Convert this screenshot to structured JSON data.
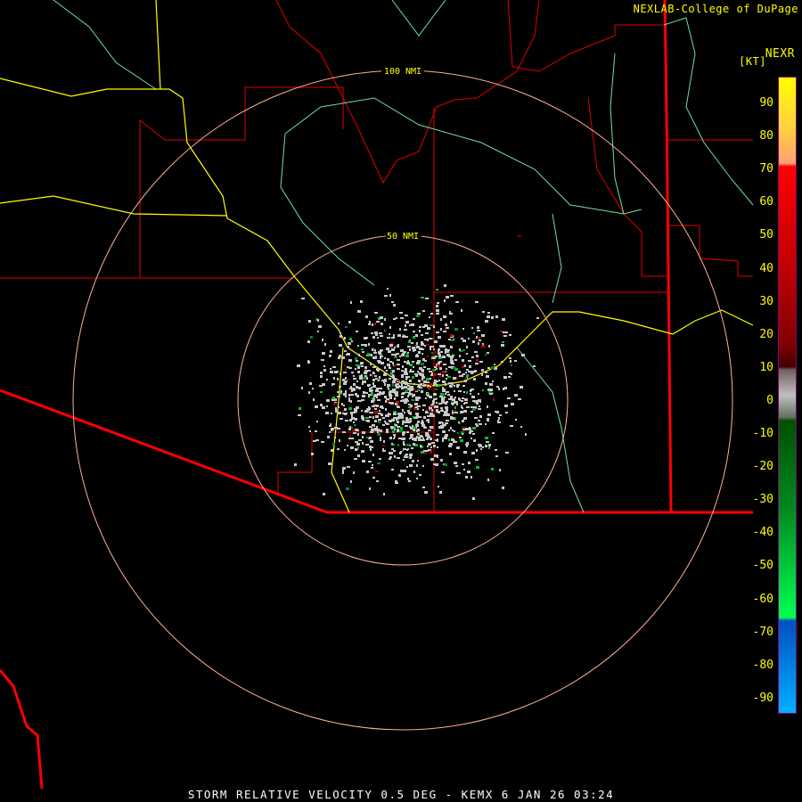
{
  "header": {
    "credit": "NEXLAB-College of DuPage",
    "product": "NEXR",
    "unit": "[KT]"
  },
  "rings": [
    {
      "label": "50 NMI"
    },
    {
      "label": "100 NMI"
    }
  ],
  "colorbar": {
    "ticks": [
      "90",
      "80",
      "70",
      "60",
      "50",
      "40",
      "30",
      "20",
      "10",
      "0",
      "-10",
      "-20",
      "-30",
      "-40",
      "-50",
      "-60",
      "-70",
      "-80",
      "-90"
    ],
    "colors": {
      "high": "#ffff00",
      "red": "#ff0000",
      "zero": "#c0c0c0",
      "green": "#00ff50",
      "blue": "#00b0ff"
    }
  },
  "footer": {
    "caption": "STORM RELATIVE VELOCITY 0.5 DEG - KEMX 6 JAN 26 03:24"
  }
}
